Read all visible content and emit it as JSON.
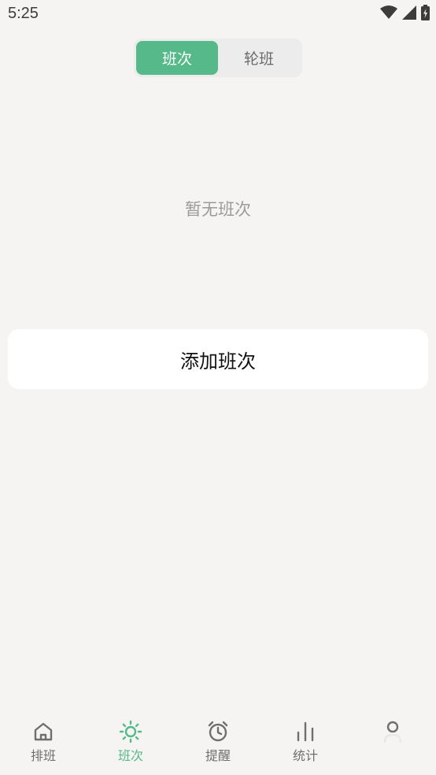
{
  "status_bar": {
    "time": "5:25",
    "icons": [
      "wifi-icon",
      "cellular-signal-icon",
      "battery-charging-icon"
    ]
  },
  "segmented_control": {
    "options": [
      {
        "label": "班次",
        "selected": true
      },
      {
        "label": "轮班",
        "selected": false
      }
    ]
  },
  "main": {
    "empty_message": "暂无班次",
    "add_button_label": "添加班次"
  },
  "tab_bar": {
    "items": [
      {
        "label": "排班",
        "icon": "home-icon",
        "active": false
      },
      {
        "label": "班次",
        "icon": "sun-icon",
        "active": true
      },
      {
        "label": "提醒",
        "icon": "alarm-clock-icon",
        "active": false
      },
      {
        "label": "统计",
        "icon": "bar-chart-icon",
        "active": false
      },
      {
        "label": "",
        "icon": "profile-icon",
        "active": false
      }
    ]
  },
  "colors": {
    "accent": "#55b98a",
    "background": "#f5f4f2",
    "card": "#ffffff",
    "muted_text": "#9a9a9a",
    "tab_inactive": "#6f6f6f"
  }
}
